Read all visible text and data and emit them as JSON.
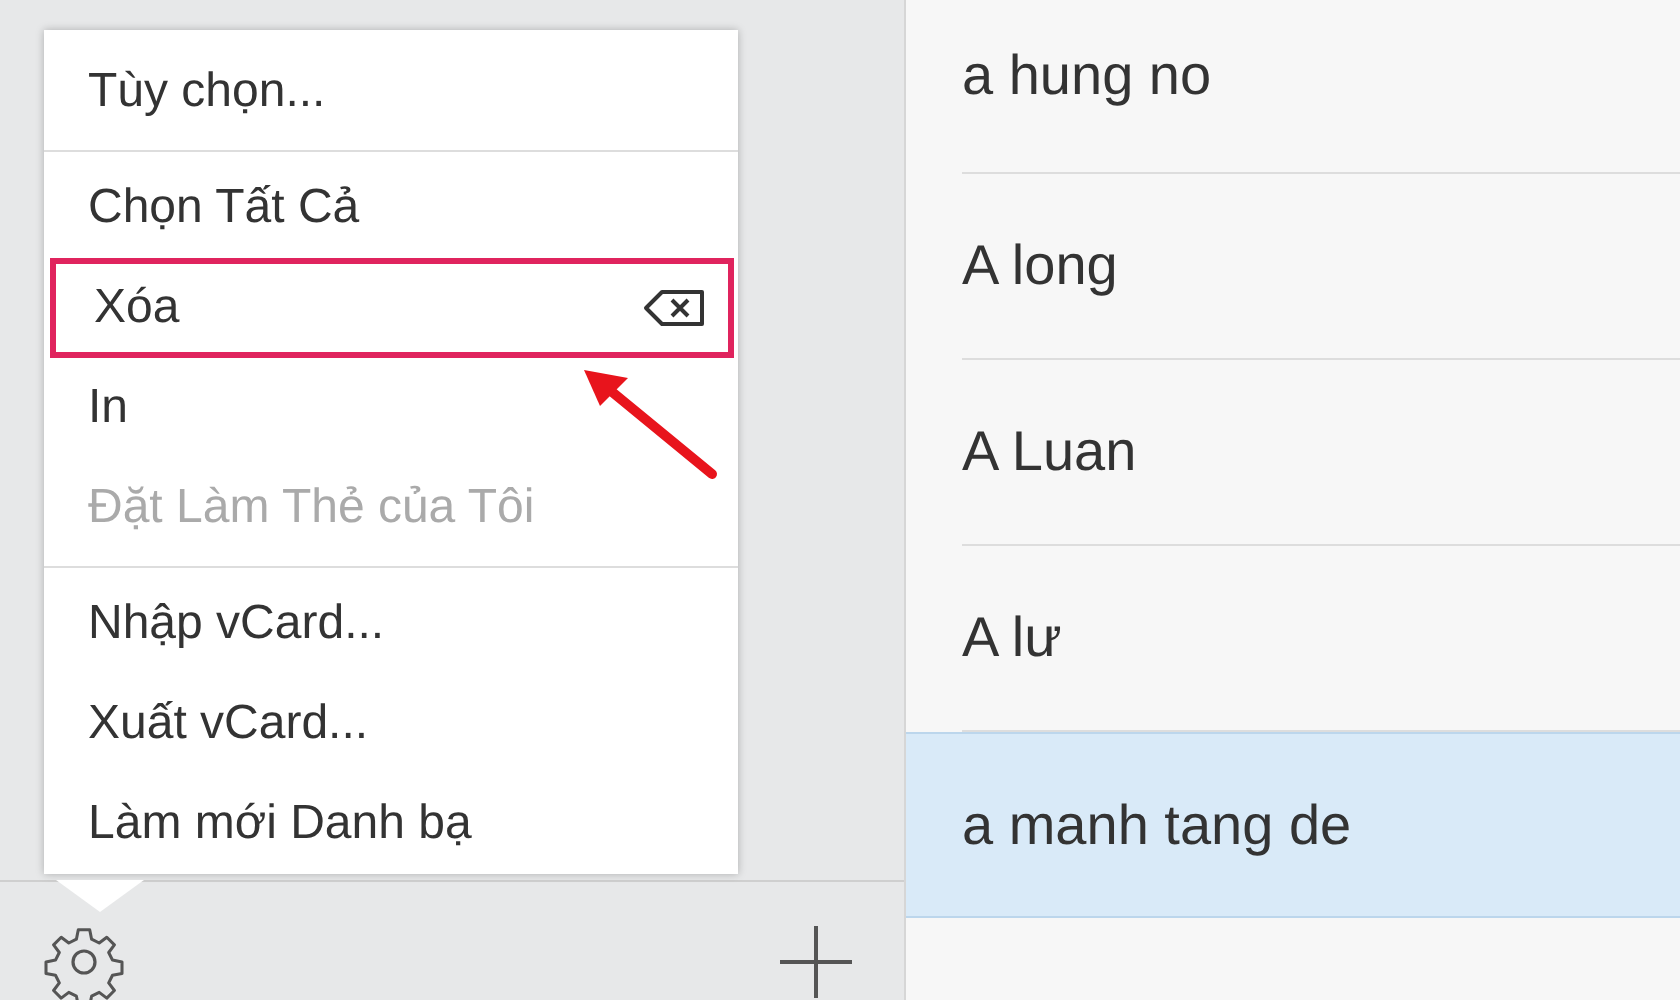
{
  "menu": {
    "items": [
      {
        "kind": "item",
        "label": "Tùy chọn...",
        "disabled": false,
        "highlighted": false,
        "shortcut": false
      },
      {
        "kind": "separator"
      },
      {
        "kind": "item",
        "label": "Chọn Tất Cả",
        "disabled": false,
        "highlighted": false,
        "shortcut": false
      },
      {
        "kind": "item",
        "label": "Xóa",
        "disabled": false,
        "highlighted": true,
        "shortcut": true
      },
      {
        "kind": "item",
        "label": "In",
        "disabled": false,
        "highlighted": false,
        "shortcut": false
      },
      {
        "kind": "item",
        "label": "Đặt Làm Thẻ của Tôi",
        "disabled": true,
        "highlighted": false,
        "shortcut": false
      },
      {
        "kind": "separator"
      },
      {
        "kind": "item",
        "label": "Nhập vCard...",
        "disabled": false,
        "highlighted": false,
        "shortcut": false
      },
      {
        "kind": "item",
        "label": "Xuất vCard...",
        "disabled": false,
        "highlighted": false,
        "shortcut": false
      },
      {
        "kind": "item",
        "label": "Làm mới Danh bạ",
        "disabled": false,
        "highlighted": false,
        "shortcut": false
      }
    ]
  },
  "contacts": [
    {
      "name": "a hung no",
      "selected": false
    },
    {
      "name": "A long",
      "selected": false
    },
    {
      "name": "A Luan",
      "selected": false
    },
    {
      "name": "A lư",
      "selected": false
    },
    {
      "name": "a manh tang de",
      "selected": true
    }
  ]
}
